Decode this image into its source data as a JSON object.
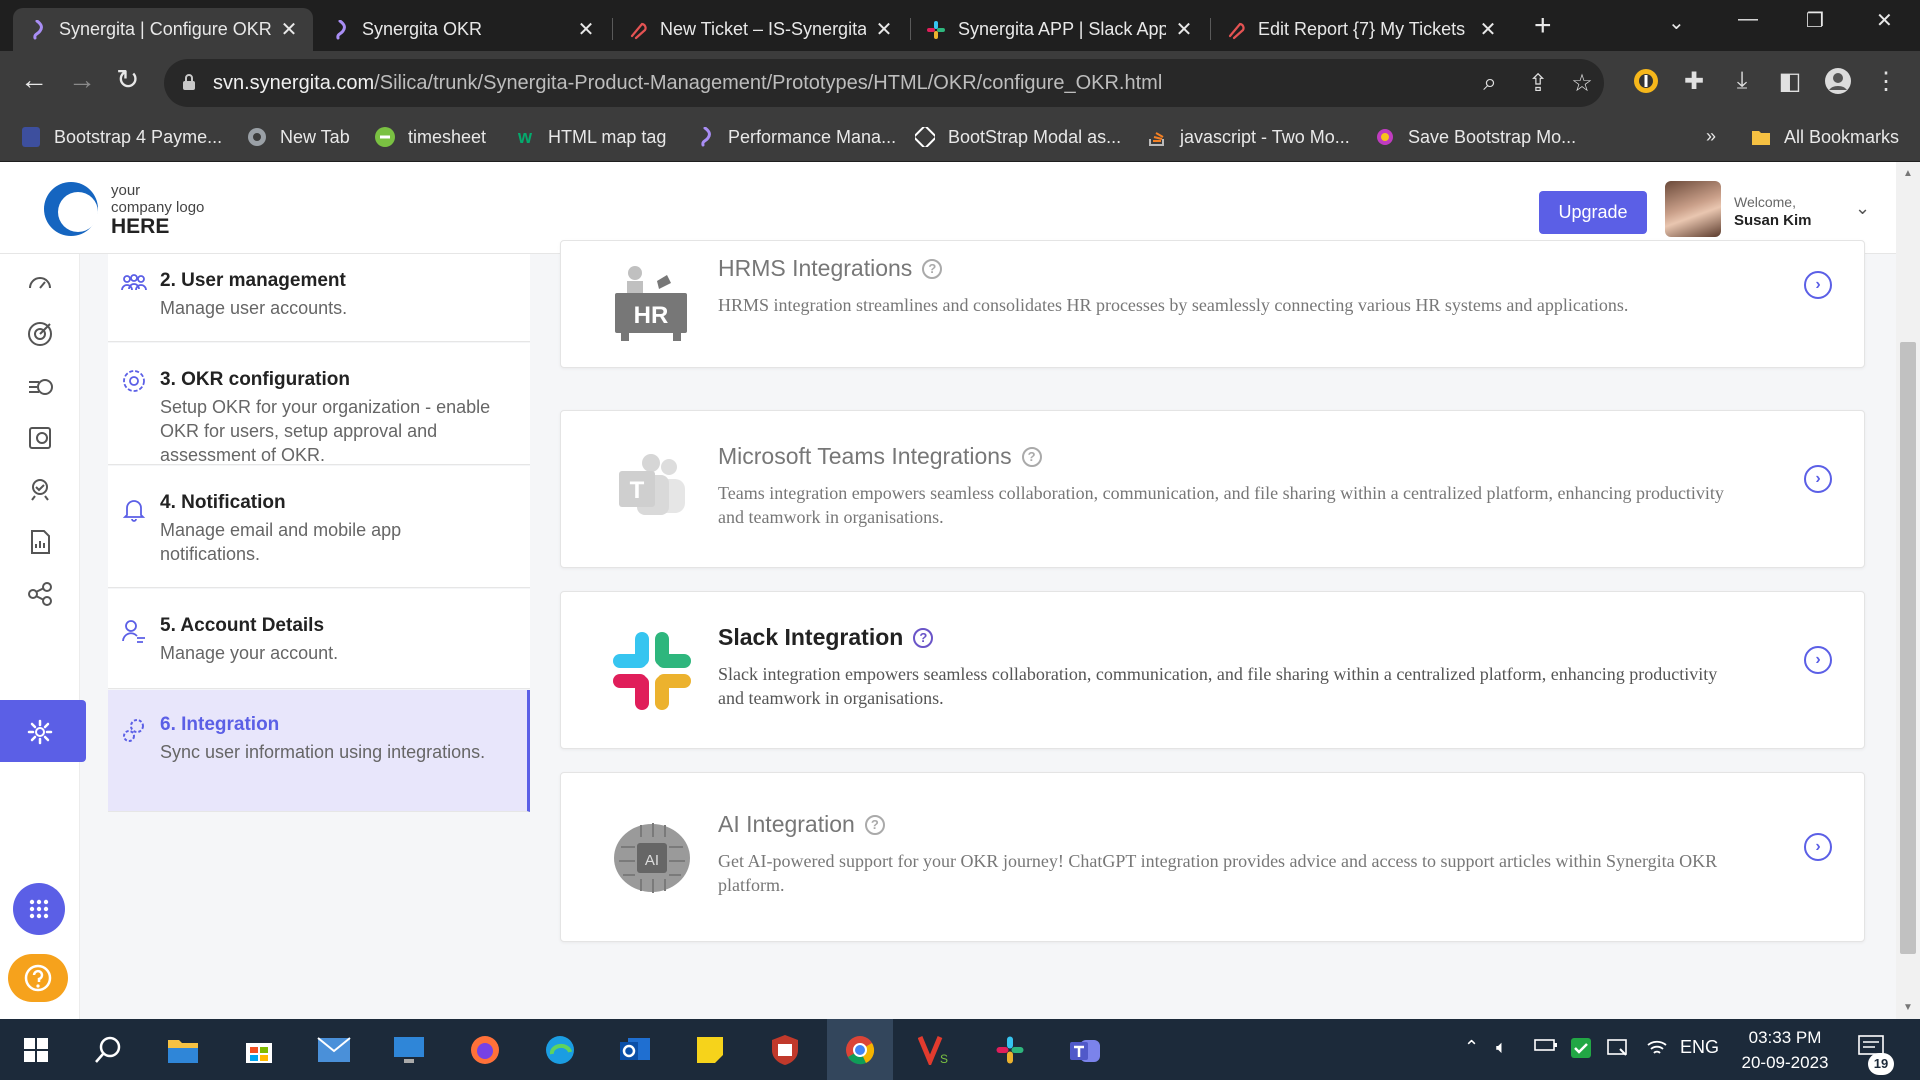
{
  "browser": {
    "tabs": [
      {
        "label": "Synergita | Configure OKR",
        "active": true
      },
      {
        "label": "Synergita OKR",
        "active": false
      },
      {
        "label": "New Ticket – IS-Synergita",
        "active": false
      },
      {
        "label": "Synergita APP | Slack App",
        "active": false
      },
      {
        "label": "Edit Report {7} My Tickets",
        "active": false
      }
    ],
    "url_host": "svn.synergita.com",
    "url_path": "/Silica/trunk/Synergita-Product-Management/Prototypes/HTML/OKR/configure_OKR.html",
    "bookmarks": [
      "Bootstrap 4 Payme...",
      "New Tab",
      "timesheet",
      "HTML map tag",
      "Performance Mana...",
      "BootStrap Modal as...",
      "javascript - Two Mo...",
      "Save Bootstrap Mo..."
    ],
    "all_bookmarks": "All Bookmarks"
  },
  "header": {
    "logo_line1": "your",
    "logo_line2": "company logo",
    "logo_line3": "HERE",
    "upgrade_label": "Upgrade",
    "welcome": "Welcome,",
    "user_name": "Susan Kim"
  },
  "menu": {
    "items": [
      {
        "title": "2. User management",
        "desc": "Manage user accounts."
      },
      {
        "title": "3. OKR configuration",
        "desc": "Setup OKR for your organization - enable OKR for users, setup approval and assessment of OKR."
      },
      {
        "title": "4. Notification",
        "desc": "Manage email and mobile app notifications."
      },
      {
        "title": "5. Account Details",
        "desc": "Manage your account."
      },
      {
        "title": "6. Integration",
        "desc": "Sync user information using integrations."
      }
    ]
  },
  "integrations": [
    {
      "title": "HRMS Integrations",
      "desc": "HRMS integration streamlines and consolidates HR processes by seamlessly connecting various HR systems and applications.",
      "logo_text": "HR"
    },
    {
      "title": "Microsoft Teams Integrations",
      "desc": "Teams integration empowers seamless collaboration, communication, and file sharing within a centralized platform, enhancing productivity and teamwork in organisations.",
      "logo_text": "T"
    },
    {
      "title": "Slack Integration",
      "desc": "Slack integration empowers seamless collaboration, communication, and file sharing within a centralized platform, enhancing productivity and teamwork in organisations."
    },
    {
      "title": "AI Integration",
      "desc": "Get AI-powered support for your OKR journey! ChatGPT integration provides advice and access to support articles within Synergita OKR platform.",
      "logo_text": "AI"
    }
  ],
  "taskbar": {
    "language": "ENG",
    "time": "03:33 PM",
    "date": "20-09-2023",
    "notifications": "19"
  },
  "colors": {
    "accent": "#5b5fe6",
    "help": "#f6a21c",
    "active_menu_bg": "#e8e6fb"
  }
}
